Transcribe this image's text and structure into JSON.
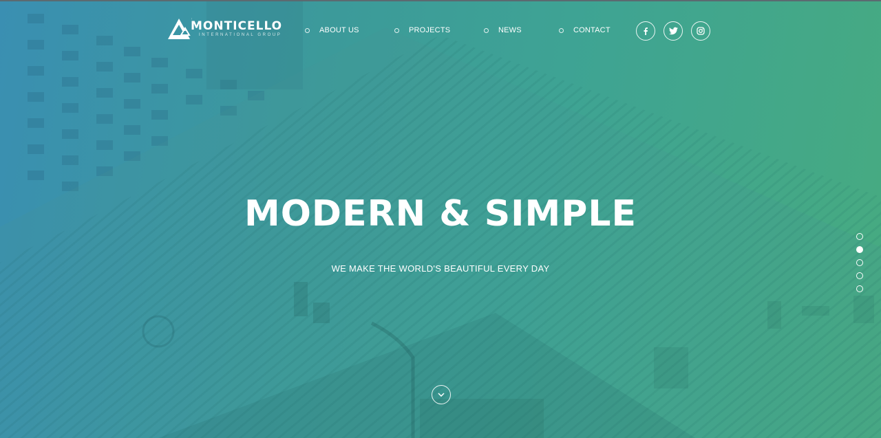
{
  "brand": {
    "name": "MONTICELLO",
    "subtitle": "INTERNATIONAL GROUP"
  },
  "nav": {
    "items": [
      {
        "label": "ABOUT US"
      },
      {
        "label": "PROJECTS"
      },
      {
        "label": "NEWS"
      },
      {
        "label": "CONTACT"
      }
    ]
  },
  "social": [
    {
      "icon": "facebook-icon"
    },
    {
      "icon": "twitter-icon"
    },
    {
      "icon": "instagram-icon"
    }
  ],
  "hero": {
    "headline": "MODERN & SIMPLE",
    "tagline": "WE MAKE THE WORLD'S BEAUTIFUL EVERY DAY"
  },
  "pager": {
    "total": 5,
    "active_index": 1
  },
  "colors": {
    "gradient_left": "#3a8fb2",
    "gradient_right": "#47ab80",
    "text": "#ffffff"
  }
}
